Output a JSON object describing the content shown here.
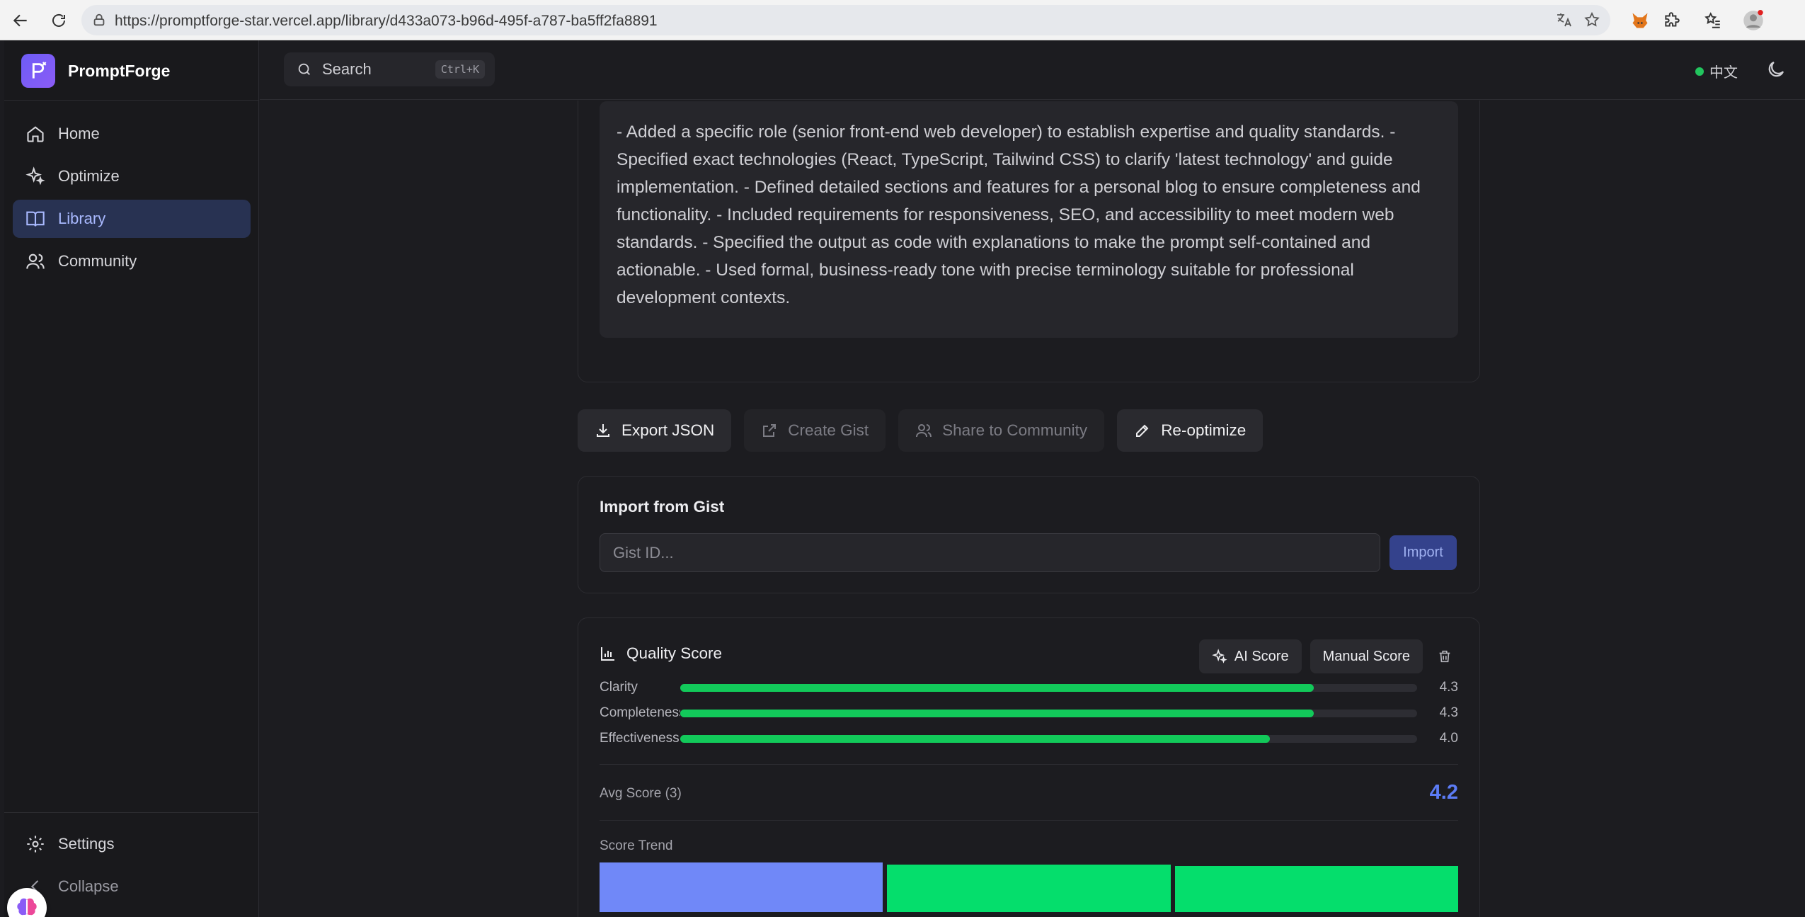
{
  "browser": {
    "url": "https://promptforge-star.vercel.app/library/d433a073-b96d-495f-a787-ba5ff2fa8891"
  },
  "app": {
    "brand_name": "PromptForge",
    "search": {
      "label": "Search",
      "shortcut": "Ctrl+K"
    },
    "language": "中文",
    "status_color": "#22c55e"
  },
  "sidebar": {
    "items": [
      {
        "label": "Home",
        "icon": "home-icon"
      },
      {
        "label": "Optimize",
        "icon": "sparkles-icon"
      },
      {
        "label": "Library",
        "icon": "book-open-icon",
        "active": true
      },
      {
        "label": "Community",
        "icon": "users-icon"
      }
    ],
    "settings_label": "Settings",
    "collapse_label": "Collapse"
  },
  "changes": {
    "text": "- Added a specific role (senior front-end web developer) to establish expertise and quality standards. - Specified exact technologies (React, TypeScript, Tailwind CSS) to clarify 'latest technology' and guide implementation. - Defined detailed sections and features for a personal blog to ensure completeness and functionality. - Included requirements for responsiveness, SEO, and accessibility to meet modern web standards. - Specified the output as code with explanations to make the prompt self-contained and actionable. - Used formal, business-ready tone with precise terminology suitable for professional development contexts."
  },
  "actions": {
    "export_json": "Export JSON",
    "create_gist": "Create Gist",
    "share_to_community": "Share to Community",
    "re_optimize": "Re-optimize"
  },
  "gist_import": {
    "title": "Import from Gist",
    "placeholder": "Gist ID...",
    "button": "Import"
  },
  "quality_score": {
    "title": "Quality Score",
    "ai_score_label": "AI Score",
    "manual_score_label": "Manual Score",
    "max_score": 5,
    "metrics": [
      {
        "label": "Clarity",
        "value": "4.3",
        "score": 4.3
      },
      {
        "label": "Completeness",
        "value": "4.3",
        "score": 4.3
      },
      {
        "label": "Effectiveness",
        "value": "4.0",
        "score": 4.0
      }
    ],
    "avg_label": "Avg Score (3)",
    "avg_value": "4.2",
    "trend_label": "Score Trend",
    "trend": [
      {
        "score": 4.2,
        "color": "#7088f8"
      },
      {
        "score": 3.9,
        "color": "#05de6c"
      },
      {
        "score": 3.6,
        "color": "#05de6c"
      }
    ],
    "bar_color": "#12c95a",
    "accent_color": "#5c7cf6"
  }
}
